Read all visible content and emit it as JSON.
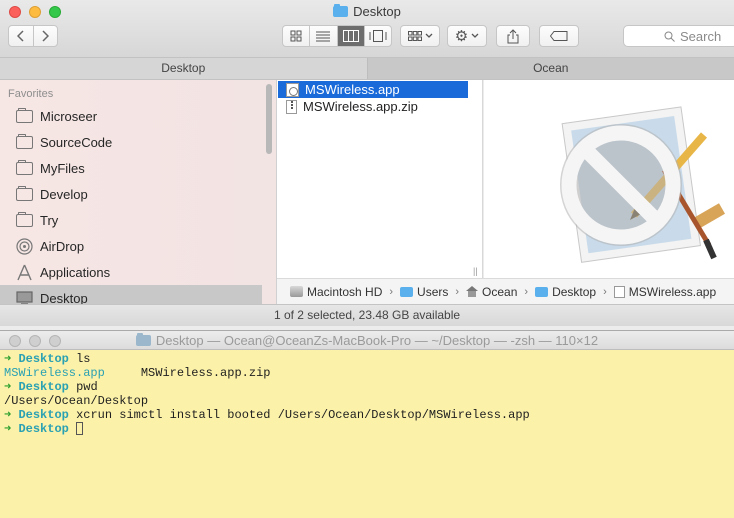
{
  "finder": {
    "title": "Desktop",
    "nav": {
      "back_icon": "chevron-left-icon",
      "forward_icon": "chevron-right-icon"
    },
    "search_placeholder": "Search",
    "tabs": [
      {
        "label": "Desktop"
      },
      {
        "label": "Ocean"
      }
    ],
    "sidebar": {
      "heading": "Favorites",
      "items": [
        {
          "label": "Microseer",
          "icon": "folder-icon"
        },
        {
          "label": "SourceCode",
          "icon": "folder-icon"
        },
        {
          "label": "MyFiles",
          "icon": "folder-icon"
        },
        {
          "label": "Develop",
          "icon": "folder-icon"
        },
        {
          "label": "Try",
          "icon": "folder-icon"
        },
        {
          "label": "AirDrop",
          "icon": "airdrop-icon"
        },
        {
          "label": "Applications",
          "icon": "applications-icon"
        },
        {
          "label": "Desktop",
          "icon": "desktop-icon"
        }
      ]
    },
    "files": [
      {
        "name": "MSWireless.app",
        "selected": true
      },
      {
        "name": "MSWireless.app.zip",
        "selected": false
      }
    ],
    "path": [
      "Macintosh HD",
      "Users",
      "Ocean",
      "Desktop",
      "MSWireless.app"
    ],
    "status": "1 of 2 selected, 23.48 GB available"
  },
  "terminal": {
    "title": "Desktop — Ocean@OceanZs-MacBook-Pro — ~/Desktop — -zsh — 110×12",
    "lines": [
      {
        "prompt": "Desktop",
        "command": "ls"
      },
      {
        "output_app": "MSWireless.app",
        "output_rest": "MSWireless.app.zip"
      },
      {
        "prompt": "Desktop",
        "command": "pwd"
      },
      {
        "output": "/Users/Ocean/Desktop"
      },
      {
        "prompt": "Desktop",
        "command": "xcrun simctl install booted /Users/Ocean/Desktop/MSWireless.app"
      },
      {
        "prompt": "Desktop",
        "command": ""
      }
    ]
  },
  "colors": {
    "selection": "#1b6ad9",
    "terminal_bg": "#fbf1a9",
    "prompt_arrow": "#2ea02e",
    "prompt_dir": "#2aa1b3"
  }
}
